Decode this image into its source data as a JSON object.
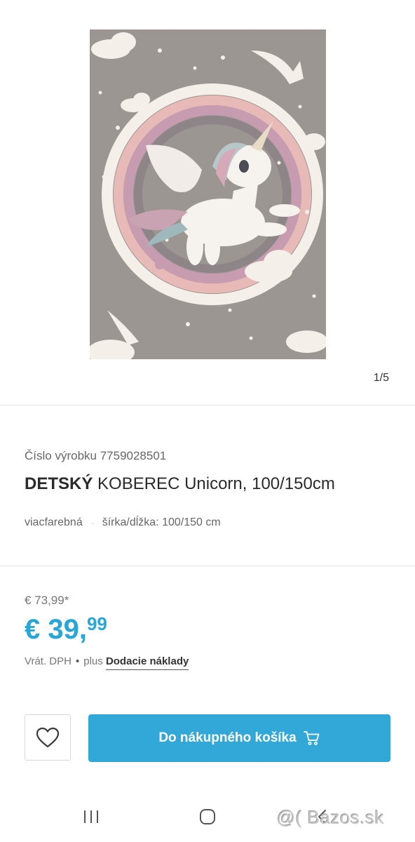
{
  "gallery": {
    "counter": "1/5",
    "image_alt": "Detský koberec Unicorn"
  },
  "product": {
    "sku_label": "Číslo výrobku 7759028501",
    "title_bold": "DETSKÝ",
    "title_rest": "KOBEREC Unicorn, 100/150cm",
    "attribute_color": "viacfarebná",
    "attribute_size": "šírka/dĺžka: 100/150 cm"
  },
  "pricing": {
    "old_price": "€ 73,99*",
    "price_main": "€ 39,",
    "price_cents": "99",
    "vat_text": "Vrát. DPH",
    "plus_text": "plus",
    "shipping_link": "Dodacie náklady",
    "accent_color": "#2aa6d6"
  },
  "actions": {
    "wishlist_icon": "heart-icon",
    "cart_label": "Do nákupného košíka",
    "cart_icon": "shopping-cart-icon"
  },
  "system_nav": {
    "recents_icon": "recents-icon",
    "home_icon": "home-icon",
    "back_icon": "back-icon"
  },
  "watermark": {
    "text": "@( Bazos.sk"
  }
}
